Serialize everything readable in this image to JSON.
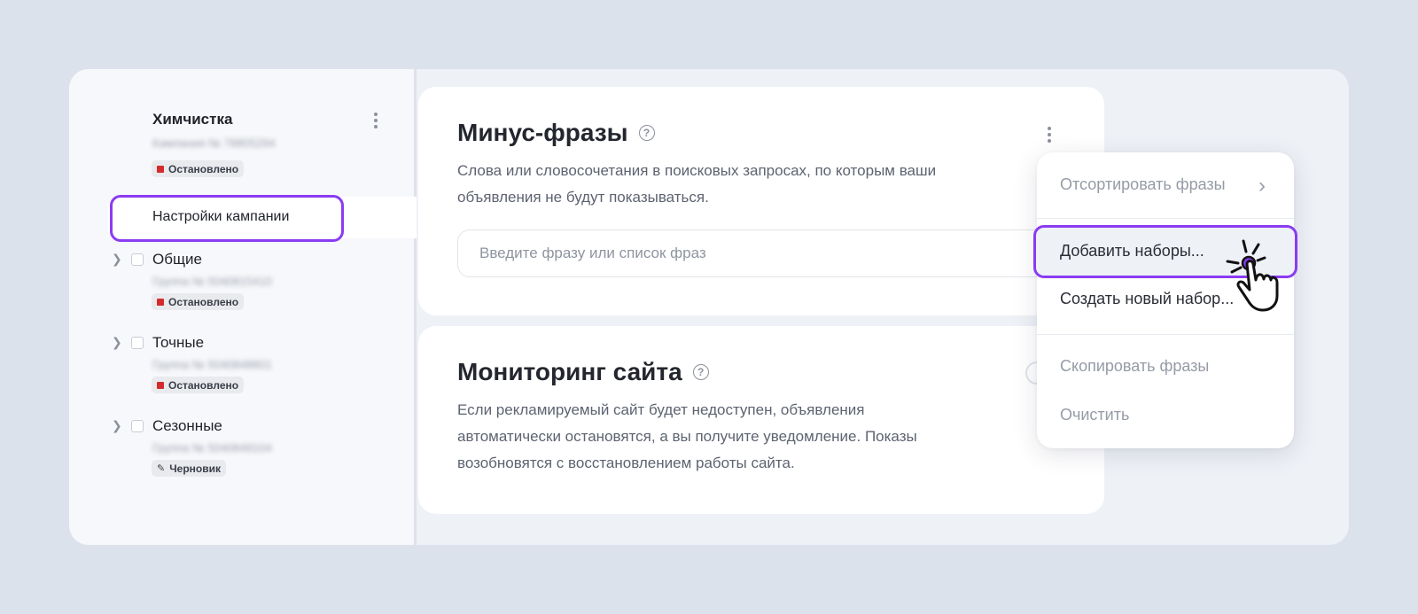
{
  "sidebar": {
    "campaign": {
      "title": "Химчистка",
      "subtitle": "Кампания № 78805294",
      "status": "Остановлено"
    },
    "settings_label": "Настройки кампании",
    "groups": [
      {
        "name": "Общие",
        "subtitle": "Группа № 5040815410",
        "status": "Остановлено",
        "status_type": "stopped"
      },
      {
        "name": "Точные",
        "subtitle": "Группа № 5040848801",
        "status": "Остановлено",
        "status_type": "stopped"
      },
      {
        "name": "Сезонные",
        "subtitle": "Группа № 5040849104",
        "status": "Черновик",
        "status_type": "draft"
      }
    ]
  },
  "minus_phrases": {
    "title": "Минус-фразы",
    "description_line1": "Слова или словосочетания в поисковых запросах, по которым ваши",
    "description_line2": "объявления не будут показываться.",
    "input_placeholder": "Введите фразу или список фраз"
  },
  "monitoring": {
    "title": "Мониторинг сайта",
    "description_line1": "Если рекламируемый сайт будет недоступен, объявления",
    "description_line2": "автоматически остановятся, а вы получите уведомление. Показы",
    "description_line3": "возобновятся с восстановлением работы сайта."
  },
  "menu": {
    "items": [
      {
        "label": "Отсортировать фразы",
        "enabled": false
      },
      {
        "label": "Добавить наборы...",
        "enabled": true
      },
      {
        "label": "Создать новый набор...",
        "enabled": true
      },
      {
        "label": "Скопировать фразы",
        "enabled": false
      },
      {
        "label": "Очистить",
        "enabled": false
      }
    ]
  },
  "colors": {
    "highlight": "#8b3bf2",
    "status_stopped": "#d42b2b",
    "background": "#dce2ec"
  },
  "icons": {
    "help": "?",
    "chevron_right": "›",
    "draft": "✎"
  }
}
